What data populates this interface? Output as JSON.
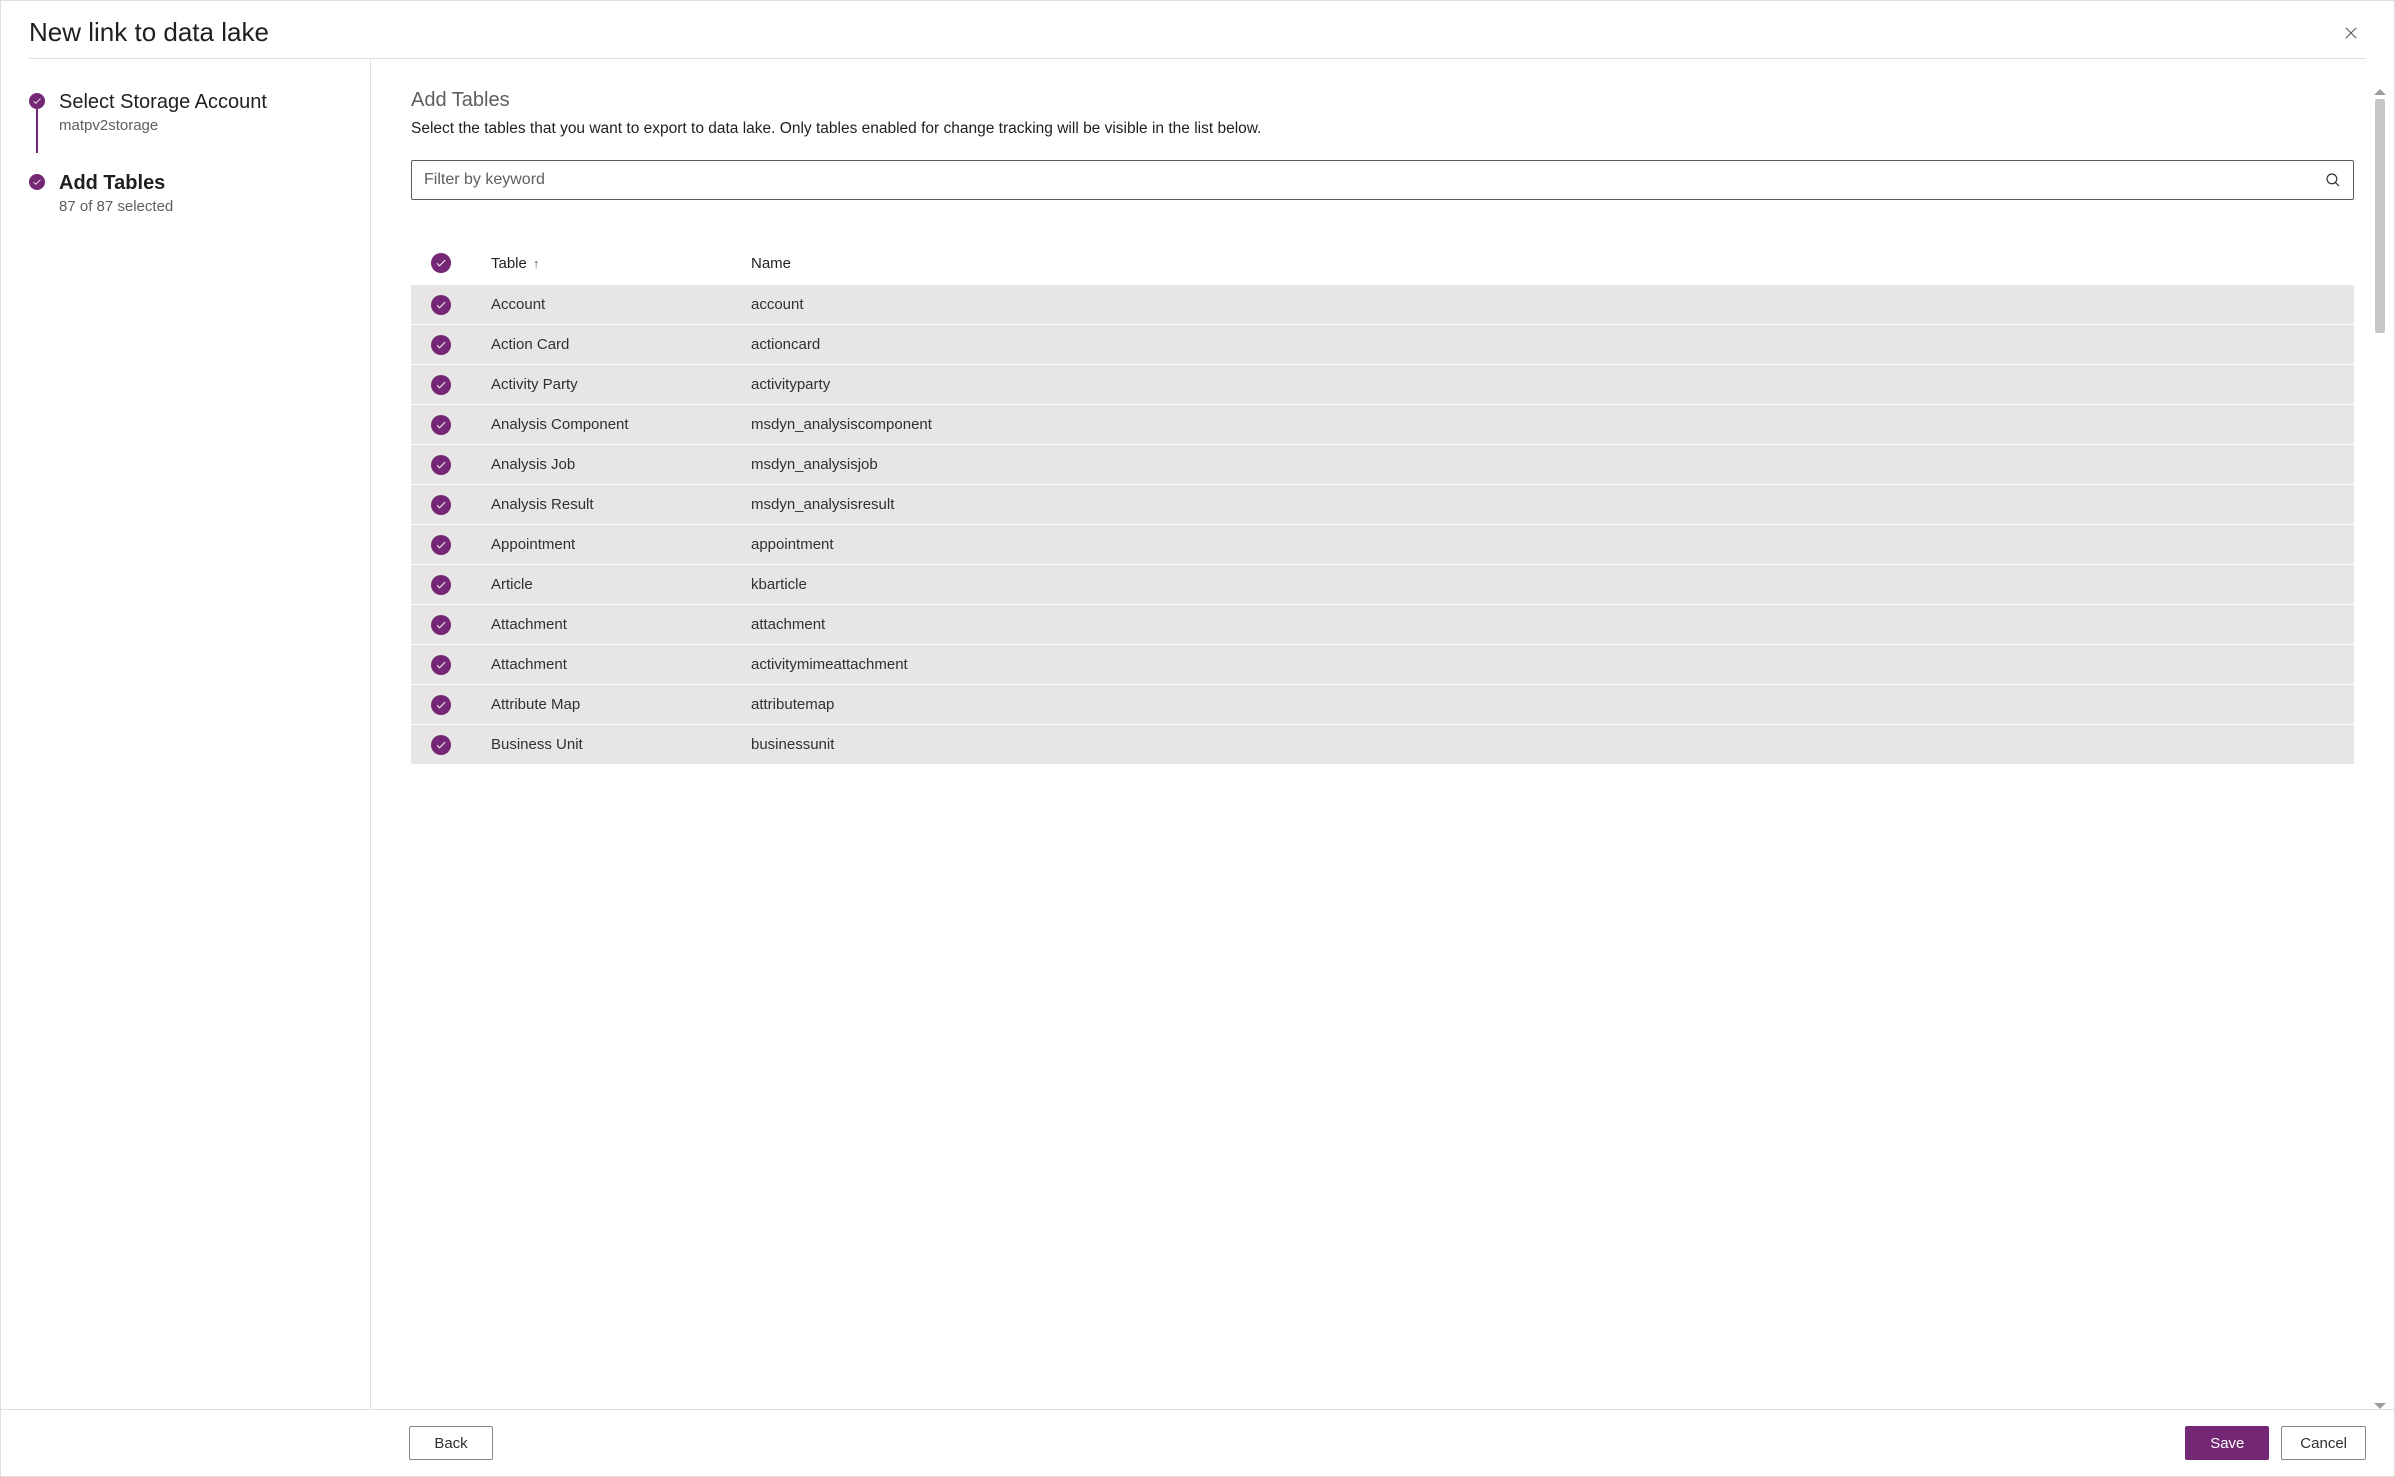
{
  "dialog": {
    "title": "New link to data lake"
  },
  "steps": {
    "storage": {
      "title": "Select Storage Account",
      "subtitle": "matpv2storage"
    },
    "addTables": {
      "title": "Add Tables",
      "subtitle": "87 of 87 selected"
    }
  },
  "main": {
    "heading": "Add Tables",
    "description": "Select the tables that you want to export to data lake. Only tables enabled for change tracking will be visible in the list below.",
    "filter_placeholder": "Filter by keyword"
  },
  "table": {
    "columns": {
      "table": "Table",
      "name": "Name"
    },
    "sort_indicator": "↑",
    "rows": [
      {
        "table": "Account",
        "name": "account"
      },
      {
        "table": "Action Card",
        "name": "actioncard"
      },
      {
        "table": "Activity Party",
        "name": "activityparty"
      },
      {
        "table": "Analysis Component",
        "name": "msdyn_analysiscomponent"
      },
      {
        "table": "Analysis Job",
        "name": "msdyn_analysisjob"
      },
      {
        "table": "Analysis Result",
        "name": "msdyn_analysisresult"
      },
      {
        "table": "Appointment",
        "name": "appointment"
      },
      {
        "table": "Article",
        "name": "kbarticle"
      },
      {
        "table": "Attachment",
        "name": "attachment"
      },
      {
        "table": "Attachment",
        "name": "activitymimeattachment"
      },
      {
        "table": "Attribute Map",
        "name": "attributemap"
      },
      {
        "table": "Business Unit",
        "name": "businessunit"
      }
    ]
  },
  "footer": {
    "back": "Back",
    "save": "Save",
    "cancel": "Cancel"
  },
  "colors": {
    "accent": "#742774"
  }
}
